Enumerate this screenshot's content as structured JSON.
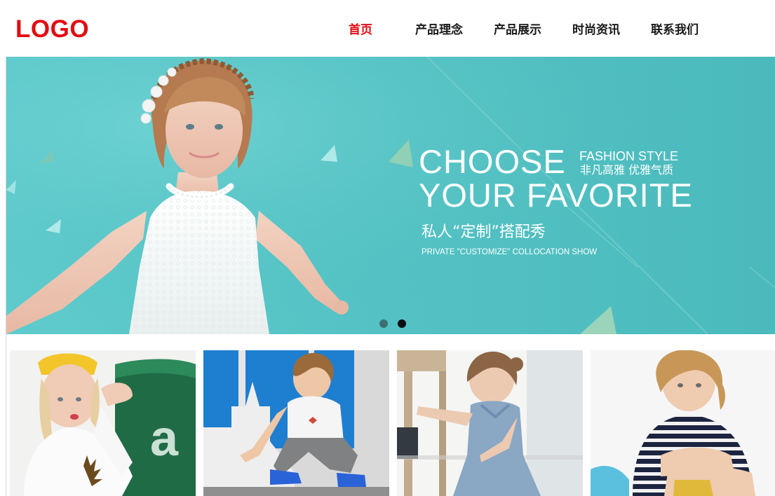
{
  "header": {
    "logo": "LOGO",
    "nav": [
      {
        "label": "首页",
        "active": true
      },
      {
        "label": "产品理念",
        "active": false
      },
      {
        "label": "产品展示",
        "active": false
      },
      {
        "label": "时尚资讯",
        "active": false
      },
      {
        "label": "联系我们",
        "active": false
      }
    ]
  },
  "banner": {
    "headline_line1": "CHOOSE",
    "headline_line2": "YOUR FAVORITE",
    "tag_en": "FASHION STYLE",
    "tag_cn": "非凡高雅 优雅气质",
    "sub_cn": "私人“定制”搭配秀",
    "sub_en": "PRIVATE \"CUSTOMIZE\" COLLOCATION SHOW",
    "dots": 2,
    "active_dot": 2
  },
  "thumbnails": [
    {
      "name": "thumb-girl-yellow-hat"
    },
    {
      "name": "thumb-boy-sitting-blue-wall"
    },
    {
      "name": "thumb-girl-blue-dress"
    },
    {
      "name": "thumb-boy-striped-shirt"
    }
  ],
  "colors": {
    "brand_red": "#e30b12",
    "banner_teal": "#55c3c5",
    "dot_inactive": "#3b6f73",
    "dot_active": "#0b0f10"
  }
}
